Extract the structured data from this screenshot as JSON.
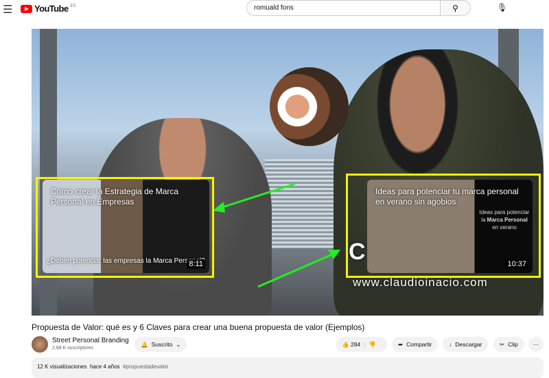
{
  "header": {
    "logo_text": "YouTube",
    "country": "ES",
    "search_value": "romuald fons",
    "menu_icon": "hamburger-icon",
    "search_icon": "search-icon",
    "mic_icon": "mic-icon",
    "clear_icon": "close-icon"
  },
  "video": {
    "watermark": "www.claudioinacio.com",
    "watermark_letter": "C",
    "cards": [
      {
        "title": "Cómo crear la Estrategia de Marca Personal en Empresas",
        "caption": "¿Deben potenciar las empresas la Marca Personal?",
        "duration": "8:11"
      },
      {
        "title": "Ideas para potenciar tu marca personal en verano sin agobios",
        "side_text_1": "Ideas para potenciar",
        "side_text_2": "la",
        "side_text_bold": "Marca Personal",
        "side_text_3": "en verano",
        "duration": "10:37"
      }
    ],
    "frame_color": "#f5f500",
    "arrow_color": "#22ee22"
  },
  "title": "Propuesta de Valor: qué es y 6 Claves para crear una buena propuesta de valor (Ejemplos)",
  "channel": {
    "name": "Street Personal Branding",
    "subscribers": "2,68 K suscriptores",
    "subscribe_label": "Suscrito"
  },
  "actions": {
    "likes": "284",
    "share": "Compartir",
    "download": "Descargar",
    "clip": "Clip",
    "more": "···"
  },
  "description": {
    "views": "12 K visualizaciones",
    "date": "hace 4 años",
    "hashtag": "#propuestadevalor"
  }
}
